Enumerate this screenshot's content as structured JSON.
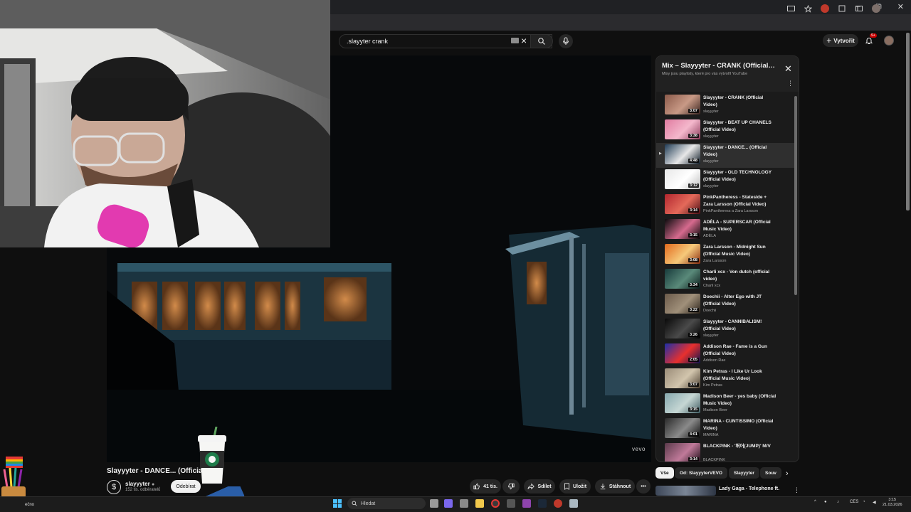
{
  "browser": {
    "window_controls": {
      "minimize": "–",
      "maximize": "⧉",
      "close": "✕"
    }
  },
  "header": {
    "search": {
      "value": ".slayyter crank"
    },
    "create_label": "Vytvořit",
    "notifications_badge": "9+"
  },
  "video": {
    "title": "Slayyyter - DANCE... (Official",
    "watermark": "vevo",
    "channel": {
      "name": "slayyyter",
      "subscribers": "152 tis. odběratelů"
    },
    "subscribe_label": "Odebírat",
    "likes_label": "41 tis.",
    "share_label": "Sdílet",
    "save_label": "Uložit",
    "download_label": "Stáhnout",
    "more_label": "•••"
  },
  "playlist": {
    "title": "Mix – Slayyyter - CRANK (Official…",
    "subtitle": "Mixy jsou playlisty, které pro vás vytvořil YouTube",
    "active_index": 2,
    "items": [
      {
        "title": "Slayyyter - CRANK (Official Video)",
        "channel": "slayyyter",
        "duration": "3:07",
        "thumb": [
          "#8b5a4a",
          "#c99a86",
          "#3a2420"
        ]
      },
      {
        "title": "Slayyyter - BEAT UP CHANELS (Official Video)",
        "channel": "slayyyter",
        "duration": "3:38",
        "thumb": [
          "#e07ba0",
          "#f4b8cc",
          "#8c3a5a"
        ]
      },
      {
        "title": "Slayyyter - DANCE... (Official Video)",
        "channel": "slayyyter",
        "duration": "4:48",
        "thumb": [
          "#1f3b55",
          "#e8e8e8",
          "#0d1a26"
        ]
      },
      {
        "title": "Slayyyter - OLD TECHNOLOGY (Official Video)",
        "channel": "slayyyter",
        "duration": "3:12",
        "thumb": [
          "#e8e8e8",
          "#ffffff",
          "#bcbcbc"
        ]
      },
      {
        "title": "PinkPantheress - Stateside + Zara Larsson (Official Video)",
        "channel": "PinkPantheress a Zara Larsson",
        "duration": "3:14",
        "thumb": [
          "#b2262e",
          "#e46a5a",
          "#4a0e14"
        ]
      },
      {
        "title": "ADÈLA - SUPERSCAR (Official Music Video)",
        "channel": "ADÈLA",
        "duration": "3:15",
        "thumb": [
          "#0b0b0d",
          "#d66a8e",
          "#050505"
        ]
      },
      {
        "title": "Zara Larsson - Midnight Sun (Official Music Video)",
        "channel": "Zara Larsson",
        "duration": "3:08",
        "thumb": [
          "#e26a1d",
          "#f6c97a",
          "#8a2d10"
        ]
      },
      {
        "title": "Charli xcx - Von dutch (official video)",
        "channel": "Charli xcx",
        "duration": "3:34",
        "thumb": [
          "#173a3b",
          "#5a8a7a",
          "#0a1a1a"
        ]
      },
      {
        "title": "Doechii - Alter Ego with JT (Official Video)",
        "channel": "Doechii",
        "duration": "3:22",
        "thumb": [
          "#6b5a4a",
          "#a0907a",
          "#2a221a"
        ]
      },
      {
        "title": "Slayyyter - CANNIBALISM! (Official Video)",
        "channel": "slayyyter",
        "duration": "3:26",
        "thumb": [
          "#0a0a0a",
          "#4a4a4a",
          "#000000"
        ]
      },
      {
        "title": "Addison Rae - Fame is a Gun (Official Video)",
        "channel": "Addison Rae",
        "duration": "2:05",
        "thumb": [
          "#1c2fa8",
          "#e8302e",
          "#0a1450"
        ]
      },
      {
        "title": "Kim Petras - I Like Ur Look (Official Music Video)",
        "channel": "Kim Petras",
        "duration": "3:07",
        "thumb": [
          "#9a8c78",
          "#d2c5ad",
          "#4a3e30"
        ]
      },
      {
        "title": "Madison Beer - yes baby (Official Music Video)",
        "channel": "Madison Beer",
        "duration": "3:15",
        "thumb": [
          "#86a7ad",
          "#c6d7d4",
          "#3e5a60"
        ]
      },
      {
        "title": "MARINA - CUNTISSIMO (Official Video)",
        "channel": "MARINA",
        "duration": "4:01",
        "thumb": [
          "#2a2a2a",
          "#8a8a8a",
          "#0a0a0a"
        ]
      },
      {
        "title": "BLACKPINK - '뛰어(JUMP)' M/V",
        "channel": "BLACKPINK",
        "duration": "3:14",
        "thumb": [
          "#5a3a4a",
          "#c07a9a",
          "#1a0a14"
        ]
      }
    ]
  },
  "chips": [
    "Vše",
    "Od: SlayyyterVEVO",
    "Slayyyter",
    "Souv"
  ],
  "next_video": {
    "title": "Lady Gaga - Telephone ft."
  },
  "taskbar": {
    "left_text": "ečno",
    "search_placeholder": "Hledat",
    "language": "CES",
    "time": "3:15",
    "date": "21.03.2026"
  }
}
